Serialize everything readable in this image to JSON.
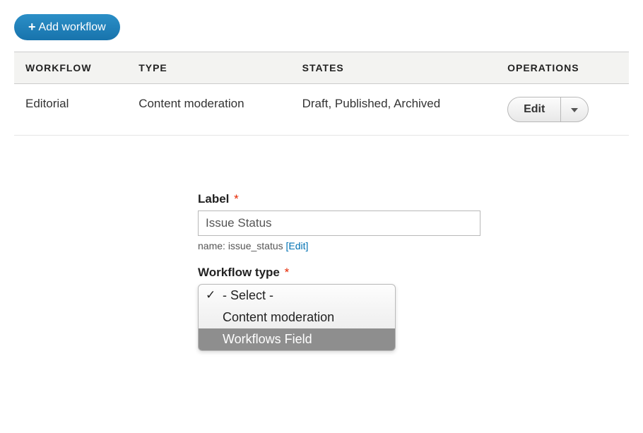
{
  "add_button": {
    "plus": "+",
    "label": "Add workflow"
  },
  "table": {
    "headers": {
      "workflow": "WORKFLOW",
      "type": "TYPE",
      "states": "STATES",
      "operations": "OPERATIONS"
    },
    "rows": [
      {
        "workflow": "Editorial",
        "type": "Content moderation",
        "states": "Draft, Published, Archived",
        "op_label": "Edit"
      }
    ]
  },
  "form": {
    "label_field": {
      "label": "Label",
      "value": "Issue Status",
      "machine_name_prefix": "name: ",
      "machine_name": "issue_status",
      "edit_link": "[Edit]"
    },
    "workflow_type": {
      "label": "Workflow type",
      "options": {
        "select": "- Select -",
        "content_mod": "Content moderation",
        "workflows_field": "Workflows Field"
      }
    }
  }
}
